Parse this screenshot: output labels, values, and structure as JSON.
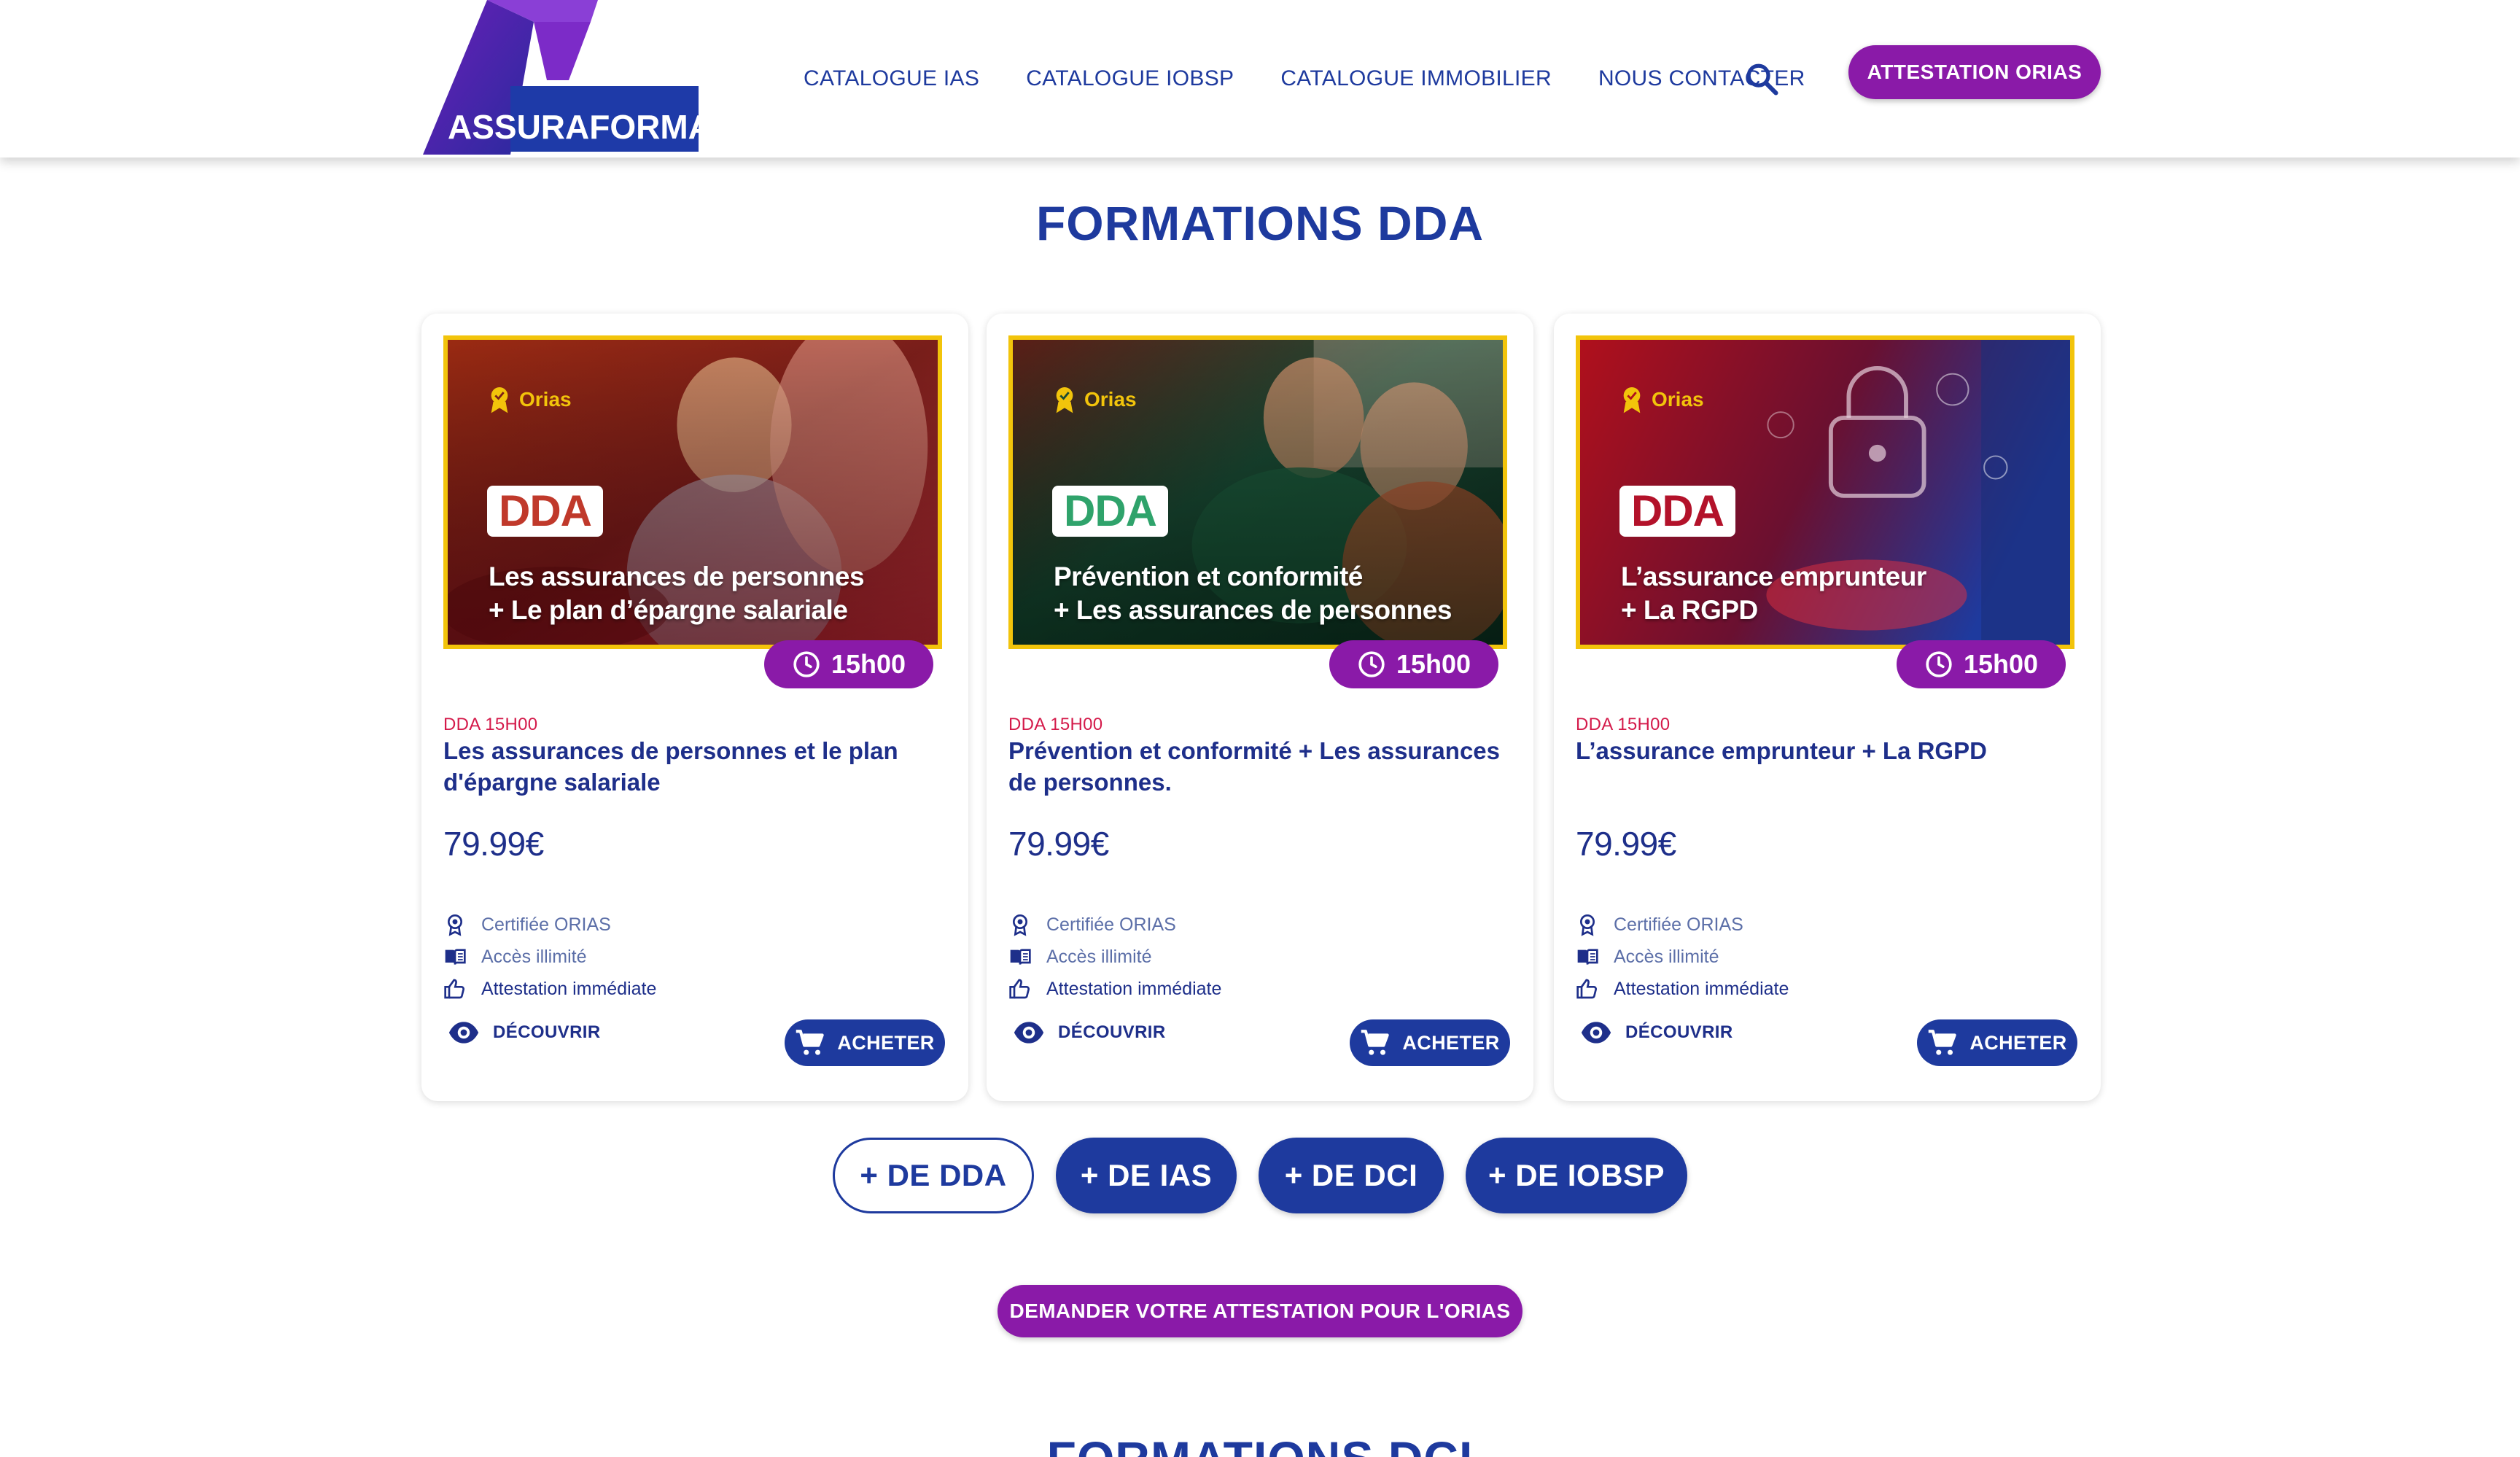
{
  "header": {
    "logo_text": "ASSURAFORMA",
    "nav": [
      "CATALOGUE IAS",
      "CATALOGUE IOBSP",
      "CATALOGUE IMMOBILIER",
      "NOUS CONTACTER"
    ],
    "cta": "ATTESTATION ORIAS"
  },
  "section": {
    "title": "FORMATIONS DDA"
  },
  "cards": [
    {
      "image_badge": "Orias",
      "image_tag": "DDA",
      "image_caption_line1": "Les assurances de personnes",
      "image_caption_line2": "+ Le plan d’épargne salariale",
      "duration": "15h00",
      "code": "DDA 15H00",
      "title": "Les assurances de personnes et le plan d'épargne salariale",
      "price": "79.99€",
      "features": [
        "Certifiée ORIAS",
        "Accès illimité",
        "Attestation immédiate"
      ],
      "discover_label": "DÉCOUVRIR",
      "buy_label": "ACHETER"
    },
    {
      "image_badge": "Orias",
      "image_tag": "DDA",
      "image_caption_line1": "Prévention et conformité",
      "image_caption_line2": "+ Les assurances de personnes",
      "duration": "15h00",
      "code": "DDA 15H00",
      "title": "Prévention et conformité + Les assurances de personnes.",
      "price": "79.99€",
      "features": [
        "Certifiée ORIAS",
        "Accès illimité",
        "Attestation immédiate"
      ],
      "discover_label": "DÉCOUVRIR",
      "buy_label": "ACHETER"
    },
    {
      "image_badge": "Orias",
      "image_tag": "DDA",
      "image_caption_line1": "L’assurance emprunteur",
      "image_caption_line2": "+ La RGPD",
      "duration": "15h00",
      "code": "DDA 15H00",
      "title": "L’assurance emprunteur + La RGPD",
      "price": "79.99€",
      "features": [
        "Certifiée ORIAS",
        "Accès illimité",
        "Attestation immédiate"
      ],
      "discover_label": "DÉCOUVRIR",
      "buy_label": "ACHETER"
    }
  ],
  "categories": [
    "+ DE DDA",
    "+ DE IAS",
    "+ DE DCI",
    "+ DE IOBSP"
  ],
  "request_cta": "DEMANDER VOTRE ATTESTATION POUR L'ORIAS",
  "next_section_title": "FORMATIONS DCI",
  "colors": {
    "primary": "#1e3a9e",
    "purple": "#8a1aa8",
    "accent_red": "#d41a4a",
    "gold": "#f2c40b",
    "card1_tag": "#c0392b",
    "card2_tag": "#2fa36b",
    "card3_tag": "#b3122a"
  }
}
